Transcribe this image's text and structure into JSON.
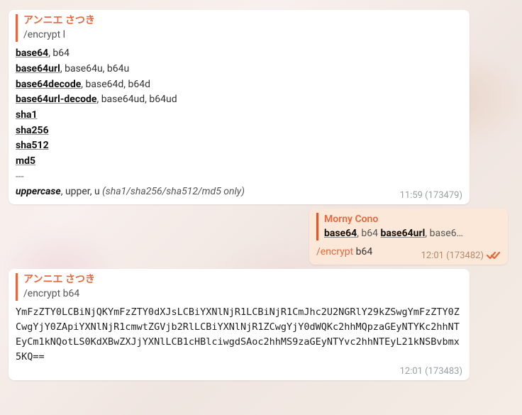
{
  "msg1": {
    "reply_name": "アンニエ さつき",
    "reply_snippet": "/encrypt l",
    "tools": [
      {
        "name": "base64",
        "aliases": ", b64"
      },
      {
        "name": "base64url",
        "aliases": ", base64u, b64u"
      },
      {
        "name": "base64decode",
        "aliases": ", base64d, b64d"
      },
      {
        "name": "base64url-decode",
        "aliases": ", base64ud, b64ud"
      },
      {
        "name": "sha1",
        "aliases": ""
      },
      {
        "name": "sha256",
        "aliases": ""
      },
      {
        "name": "sha512",
        "aliases": ""
      },
      {
        "name": "md5",
        "aliases": ""
      }
    ],
    "sep": "---",
    "opt_name": "uppercase",
    "opt_aliases": ", upper, u ",
    "opt_note": "(sha1/sha256/sha512/md5 only)",
    "time": "11:59 (173479)"
  },
  "msg2": {
    "reply_name": "Morny Cono",
    "snip_tool1": "base64",
    "snip_alias1": ", b64 ",
    "snip_tool2": "base64url",
    "snip_tail": ", base6…",
    "cmd": "/encrypt",
    "arg": " b64",
    "time": "12:01 (173482)"
  },
  "msg3": {
    "reply_name": "アンニエ さつき",
    "reply_snippet": "/encrypt b64",
    "content": "YmFzZTY0LCBiNjQKYmFzZTY0dXJsLCBiYXNlNjR1LCBiNjR1CmJhc2U2NGRlY29kZSwgYmFzZTY0ZCwgYjY0ZApiYXNlNjR1cmwtZGVjb2RlLCBiYXNlNjR1ZCwgYjY0dWQKc2hhMQpzaGEyNTYKc2hhNTEyCm1kNQotLS0KdXBwZXJjYXNlLCB1cHBlciwgdSAoc2hhMS9zaGEyNTYvc2hhNTEyL21kNSBvbmx5KQ==",
    "time": "12:01 (173483)"
  }
}
